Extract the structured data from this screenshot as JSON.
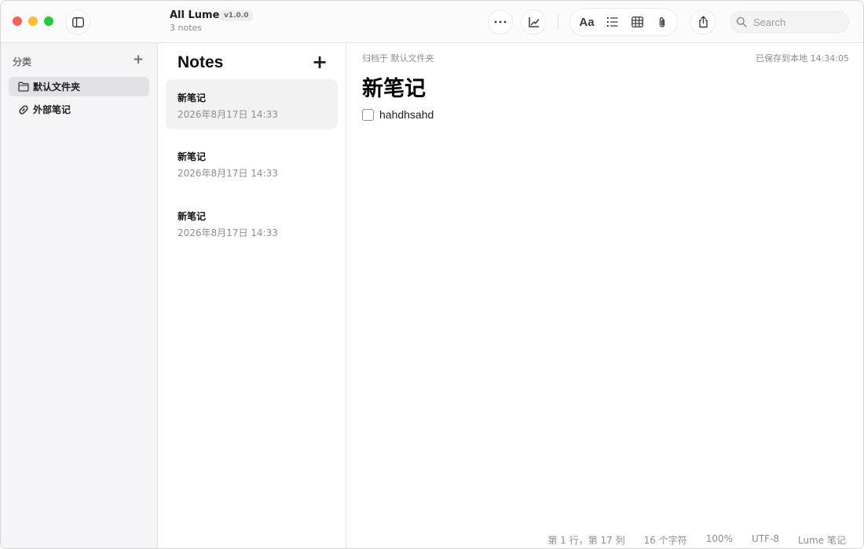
{
  "titlebar": {
    "app_title": "All Lume",
    "version": "v1.0.0",
    "subtitle": "3 notes",
    "search_placeholder": "Search",
    "format_label": "Aa"
  },
  "sidebar": {
    "heading": "分类",
    "add_label": "+",
    "items": [
      {
        "label": "默认文件夹",
        "icon": "folder-icon",
        "active": true
      },
      {
        "label": "外部笔记",
        "icon": "link-icon",
        "active": false
      }
    ]
  },
  "notes_list": {
    "title": "Notes",
    "add_label": "+",
    "items": [
      {
        "title": "新笔记",
        "date": "2026年8月17日 14:33",
        "active": true
      },
      {
        "title": "新笔记",
        "date": "2026年8月17日 14:33",
        "active": false
      },
      {
        "title": "新笔记",
        "date": "2026年8月17日 14:33",
        "active": false
      }
    ]
  },
  "editor": {
    "breadcrumb": "归档于 默认文件夹",
    "saved_status": "已保存到本地 14:34:05",
    "title": "新笔记",
    "todo_text": "hahdhsahd"
  },
  "statusbar": {
    "cursor": "第 1 行，第 17 列",
    "chars": "16 个字符",
    "zoom": "100%",
    "encoding": "UTF-8",
    "app": "Lume 笔记"
  },
  "colors": {
    "close": "#fe5f57",
    "minimize": "#febc2e",
    "maximize": "#28c840",
    "sidebar_bg": "#f5f5f7",
    "active_item_bg": "#e2e2e5"
  }
}
